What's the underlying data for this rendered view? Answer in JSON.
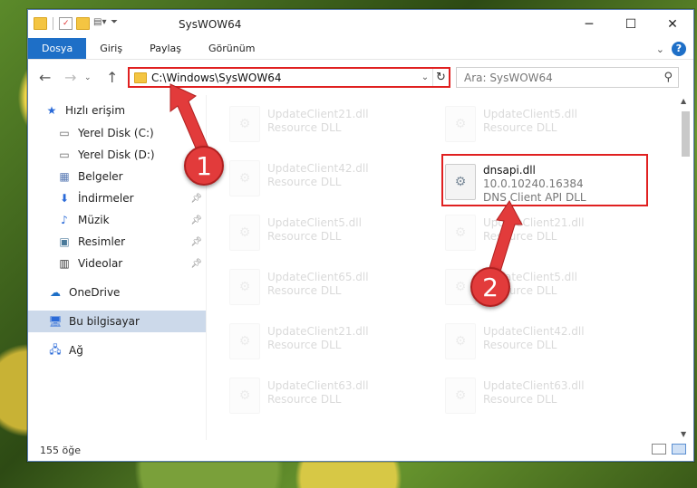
{
  "window": {
    "title": "SysWOW64",
    "minimize": "─",
    "maximize": "☐",
    "close": "✕"
  },
  "ribbon": {
    "tabs": [
      "Dosya",
      "Giriş",
      "Paylaş",
      "Görünüm"
    ]
  },
  "address": {
    "path": "C:\\Windows\\SysWOW64"
  },
  "search": {
    "placeholder": "Ara: SysWOW64"
  },
  "sidebar": {
    "items": [
      {
        "label": "Hızlı erişim",
        "icon": "star-icon",
        "pinned": false
      },
      {
        "label": "Yerel Disk (C:)",
        "icon": "drive-icon",
        "pinned": false
      },
      {
        "label": "Yerel Disk (D:)",
        "icon": "drive-icon",
        "pinned": false
      },
      {
        "label": "Belgeler",
        "icon": "documents-icon",
        "pinned": false
      },
      {
        "label": "İndirmeler",
        "icon": "download-icon",
        "pinned": true
      },
      {
        "label": "Müzik",
        "icon": "music-icon",
        "pinned": true
      },
      {
        "label": "Resimler",
        "icon": "pictures-icon",
        "pinned": true
      },
      {
        "label": "Videolar",
        "icon": "videos-icon",
        "pinned": true
      },
      {
        "label": "OneDrive",
        "icon": "cloud-icon",
        "pinned": false
      },
      {
        "label": "Bu bilgisayar",
        "icon": "computer-icon",
        "pinned": false
      },
      {
        "label": "Ağ",
        "icon": "network-icon",
        "pinned": false
      }
    ]
  },
  "files": {
    "left": [
      {
        "name": "UpdateClient21.dll",
        "desc": "Resource DLL"
      },
      {
        "name": "UpdateClient42.dll",
        "desc": "Resource DLL"
      },
      {
        "name": "UpdateClient5.dll",
        "desc": "Resource DLL"
      },
      {
        "name": "UpdateClient65.dll",
        "desc": "Resource DLL"
      },
      {
        "name": "UpdateClient21.dll",
        "desc": "Resource DLL"
      },
      {
        "name": "UpdateClient63.dll",
        "desc": "Resource DLL"
      }
    ],
    "right": [
      {
        "name": "UpdateClient5.dll",
        "desc": "Resource DLL"
      },
      {
        "name": "UpdateClient21.dll",
        "desc": "Resource DLL"
      },
      {
        "name": "UpdateClient5.dll",
        "desc": "Resource DLL"
      },
      {
        "name": "UpdateClient42.dll",
        "desc": "Resource DLL"
      },
      {
        "name": "UpdateClient63.dll",
        "desc": "Resource DLL"
      }
    ],
    "highlighted": {
      "name": "dnsapi.dll",
      "version": "10.0.10240.16384",
      "desc": "DNS Client API DLL"
    }
  },
  "callouts": [
    "1",
    "2"
  ],
  "status": {
    "count": "155 öğe"
  },
  "colors": {
    "accent": "#1e6fc7",
    "highlight_red": "#e02020",
    "callout_red": "#e23b3b"
  }
}
